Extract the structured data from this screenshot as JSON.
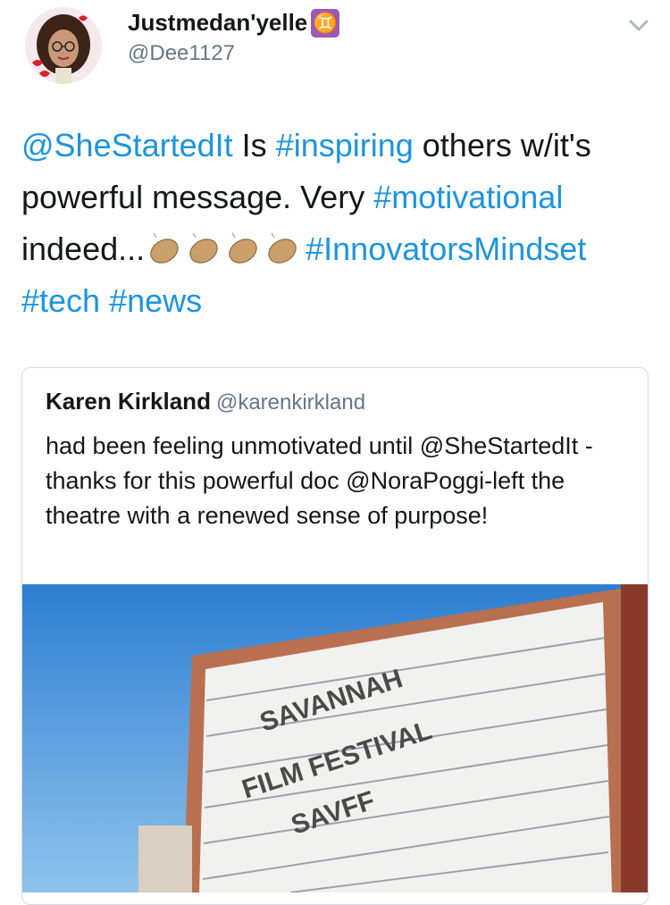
{
  "author": {
    "display_name": "Justmedan'yelle",
    "badge": "♊",
    "handle": "@Dee1127"
  },
  "tweet": {
    "parts": [
      {
        "text": "@SheStartedIt",
        "type": "mention"
      },
      {
        "text": " Is ",
        "type": "text"
      },
      {
        "text": "#inspiring",
        "type": "hashtag"
      },
      {
        "text": " others w/it's powerful message. Very ",
        "type": "text"
      },
      {
        "text": "#motivational",
        "type": "hashtag"
      },
      {
        "text": " indeed...",
        "type": "text"
      },
      {
        "text": "#InnovatorsMindset",
        "type": "hashtag"
      },
      {
        "text": "#tech",
        "type": "hashtag"
      },
      {
        "text": "#news",
        "type": "hashtag"
      }
    ],
    "emoji": "clapping-hands"
  },
  "quoted": {
    "name": "Karen Kirkland",
    "handle": "@karenkirkland",
    "text": "had been feeling unmotivated until @SheStartedIt - thanks for this powerful doc @NoraPoggi-left the theatre with a renewed sense of purpose!",
    "image_sign": {
      "line1": "SAVANNAH",
      "line2": "FILM FESTIVAL",
      "line3": "SAVFF"
    }
  },
  "colors": {
    "link": "#1b95e0",
    "text": "#14171a",
    "secondary": "#657786",
    "border": "#d6dbe0",
    "badge": "#9b59b6"
  },
  "icons": {
    "caret": "chevron-down-icon"
  }
}
